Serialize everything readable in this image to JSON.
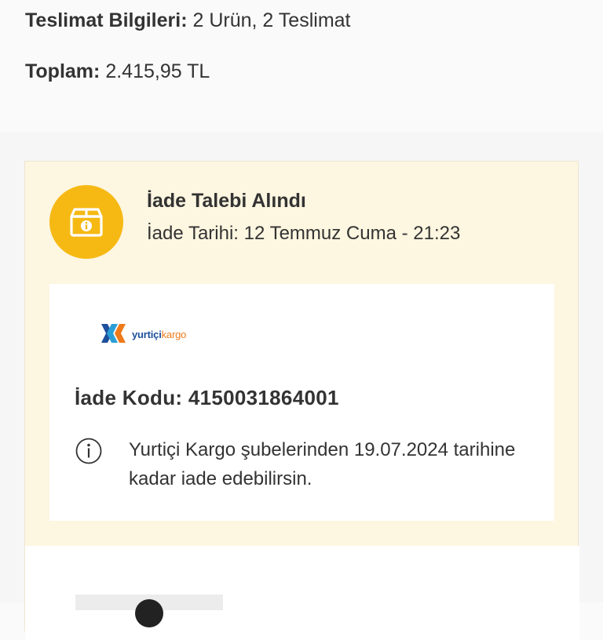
{
  "summary": {
    "delivery_key": "Teslimat Bilgileri:",
    "delivery_value": "2 Urün, 2 Teslimat",
    "total_key": "Toplam:",
    "total_value": "2.415,95 TL"
  },
  "return": {
    "status_title": "İade Talebi Alındı",
    "status_date": "İade Tarihi: 12 Temmuz Cuma - 21:23",
    "status_icon": "package-info-icon",
    "accent_color": "#f6b914",
    "card_background": "#fdf6e0",
    "carrier": {
      "logo_icon": "yurtici-kargo-logo",
      "wordmark_part1": "yurtiçi",
      "wordmark_part2": "kargo"
    },
    "code_line": "İade Kodu: 4150031864001",
    "info_icon": "info-circle-icon",
    "info_text": "Yurtiçi Kargo şubelerinden 19.07.2024 tarihine kadar iade edebilirsin."
  }
}
